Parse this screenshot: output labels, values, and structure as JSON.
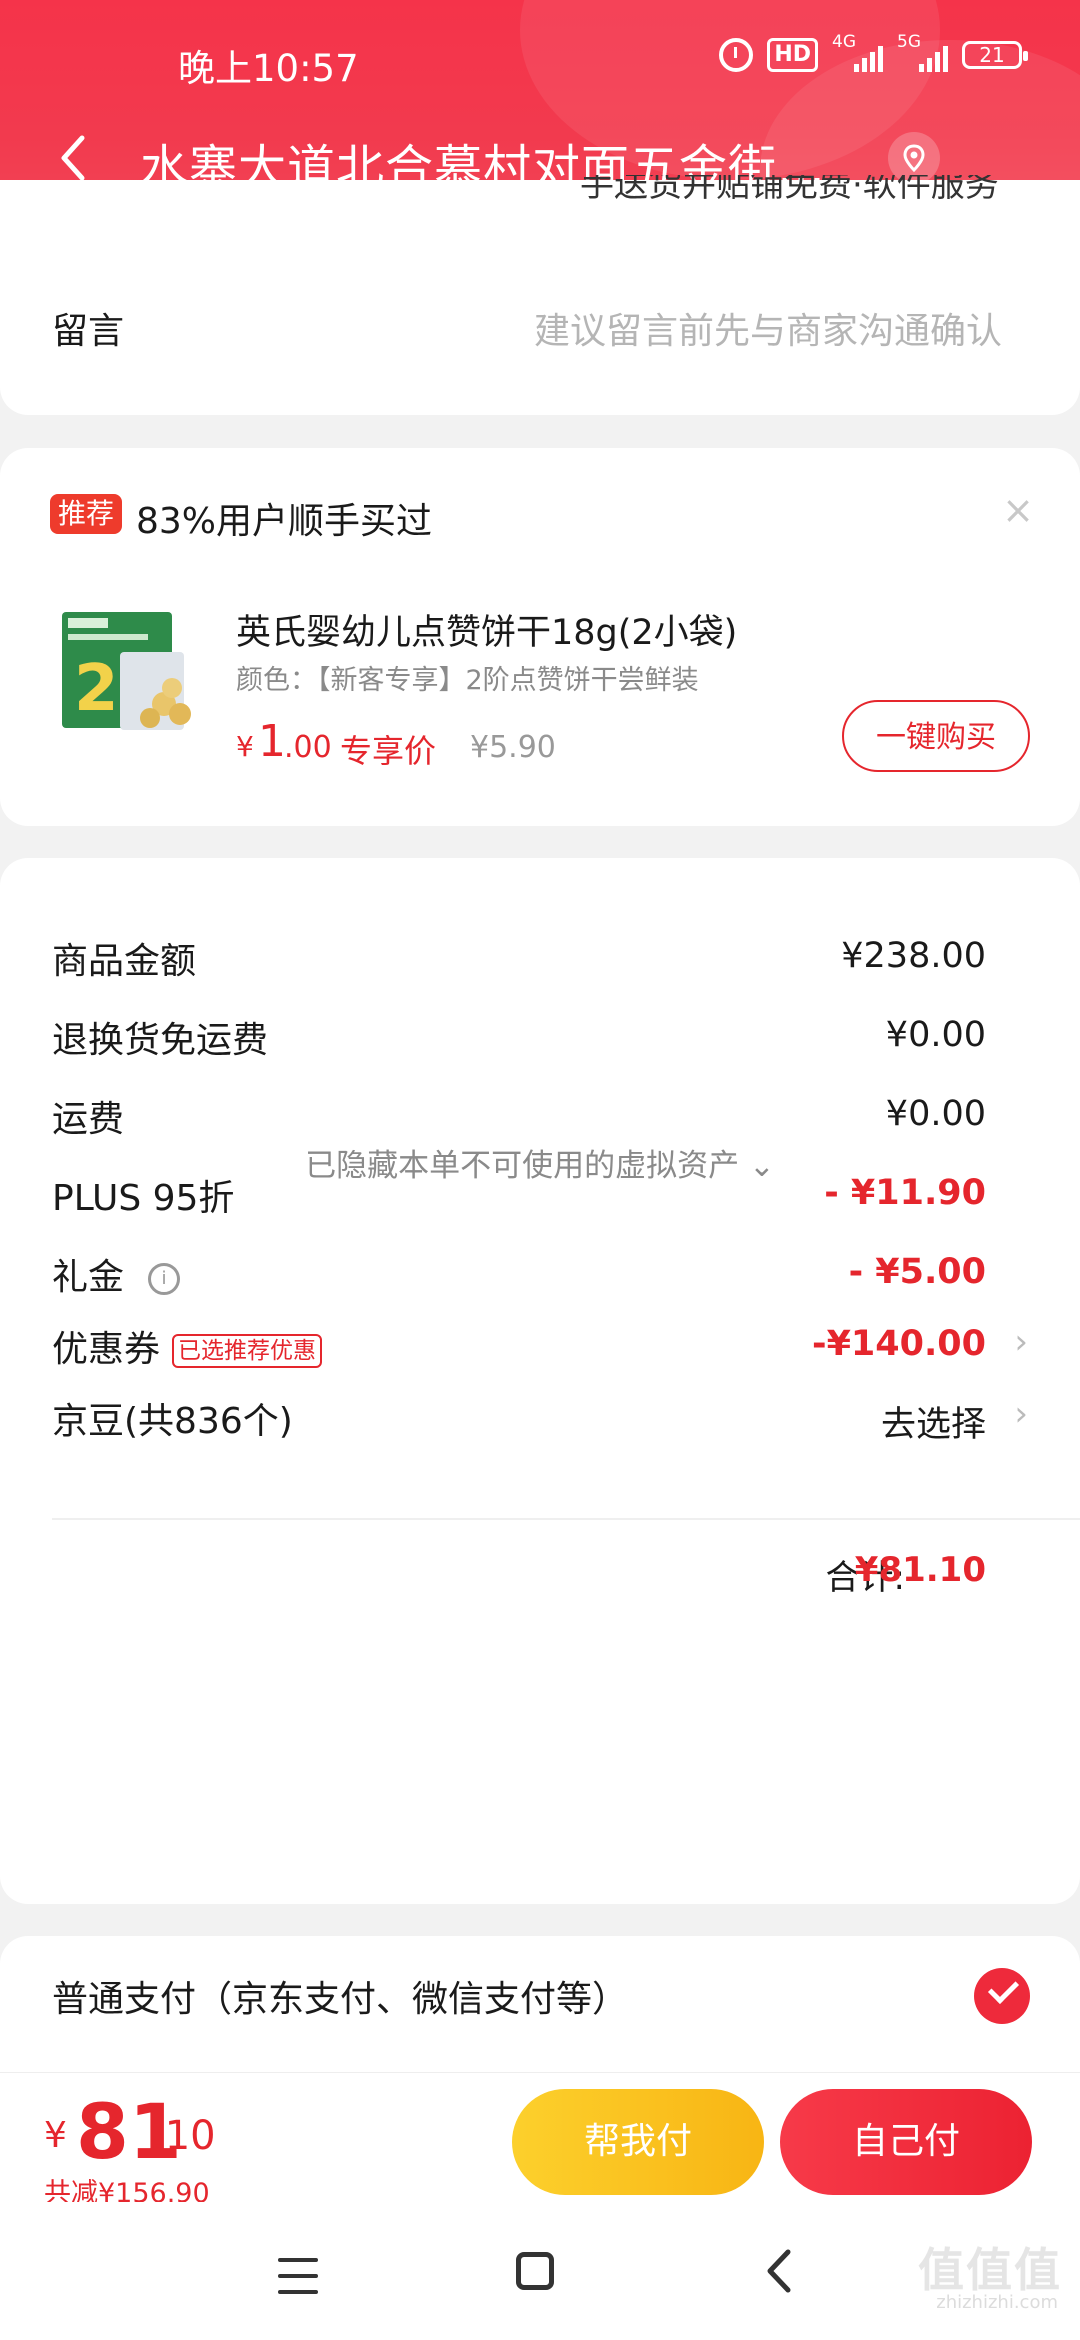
{
  "status_bar": {
    "time": "晚上10:57",
    "hd_label": "HD",
    "net1": "4G",
    "net2": "5G",
    "battery": "21"
  },
  "nav": {
    "title": "水寨大道北合慕村对面五金街…"
  },
  "note_section": {
    "partial_text": "手送货并贴铺免费·软件服务",
    "label": "留言",
    "placeholder": "建议留言前先与商家沟通确认"
  },
  "recommendation": {
    "badge": "推荐",
    "text": "83%用户顺手买过",
    "close": "×",
    "product": {
      "title": "英氏婴幼儿点赞饼干18g(2小袋)",
      "color": "颜色：【新客专享】2阶点赞饼干尝鲜装",
      "currency": "¥",
      "price_int": "1",
      "price_dec": ".00",
      "price_tag": "专享价",
      "orig_price": "¥5.90",
      "buy_label": "一键购买"
    }
  },
  "summary": {
    "rows": [
      {
        "label": "商品金额",
        "value": "¥238.00"
      },
      {
        "label": "退换货免运费",
        "value": "¥0.00"
      },
      {
        "label": "运费",
        "value": "¥0.00"
      },
      {
        "label": "PLUS 95折",
        "value": "- ¥11.90"
      },
      {
        "label": "礼金",
        "value": "- ¥5.00"
      },
      {
        "label": "优惠券",
        "tag": "已选推荐优惠",
        "value": "-¥140.00"
      },
      {
        "label": "京豆(共836个)",
        "value": "去选择"
      }
    ],
    "hidden_note": "已隐藏本单不可使用的虚拟资产 ⌄",
    "total_label": "合计:",
    "total_value": "¥81.10"
  },
  "payment": {
    "label": "普通支付（京东支付、微信支付等）"
  },
  "bottom_bar": {
    "currency": "¥",
    "amount_int": "81",
    "amount_dec": ".10",
    "saved": "共减¥156.90",
    "help_pay": "帮我付",
    "self_pay": "自己付"
  },
  "watermark": {
    "logo": "值值值",
    "site": "zhizhizhi.com"
  },
  "colors": {
    "brand_red": "#e5262d",
    "header_red": "#f5334a",
    "help_yellow": "#f8b514"
  }
}
